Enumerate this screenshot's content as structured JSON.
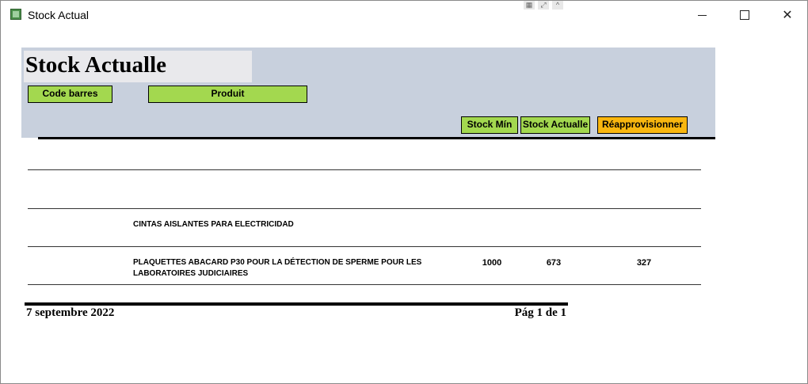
{
  "window": {
    "title": "Stock Actual"
  },
  "report": {
    "title": "Stock Actualle",
    "columns": {
      "barcode": "Code barres",
      "product": "Produit",
      "stock_min": "Stock Mín",
      "stock_actual": "Stock Actualle",
      "reorder": "Réapprovisionner"
    },
    "rows": [
      {
        "product": "",
        "stock_min": "",
        "stock_actual": "",
        "reorder": ""
      },
      {
        "product": "CINTAS AISLANTES PARA ELECTRICIDAD",
        "stock_min": "",
        "stock_actual": "",
        "reorder": ""
      },
      {
        "product": "PLAQUETTES ABACARD P30 POUR LA DÉTECTION DE SPERME POUR  LES LABORATOIRES JUDICIAIRES",
        "stock_min": "1000",
        "stock_actual": "673",
        "reorder": "327"
      }
    ],
    "footer": {
      "date": "7 septembre 2022",
      "page": "Pág 1 de 1"
    }
  },
  "colors": {
    "header_band": "#c8d0dd",
    "column_green": "#a3d84f",
    "column_orange": "#f9b60f"
  },
  "icons": {
    "app": "app-icon",
    "minimize": "minimize-icon",
    "maximize": "maximize-icon",
    "close": "close-icon"
  }
}
